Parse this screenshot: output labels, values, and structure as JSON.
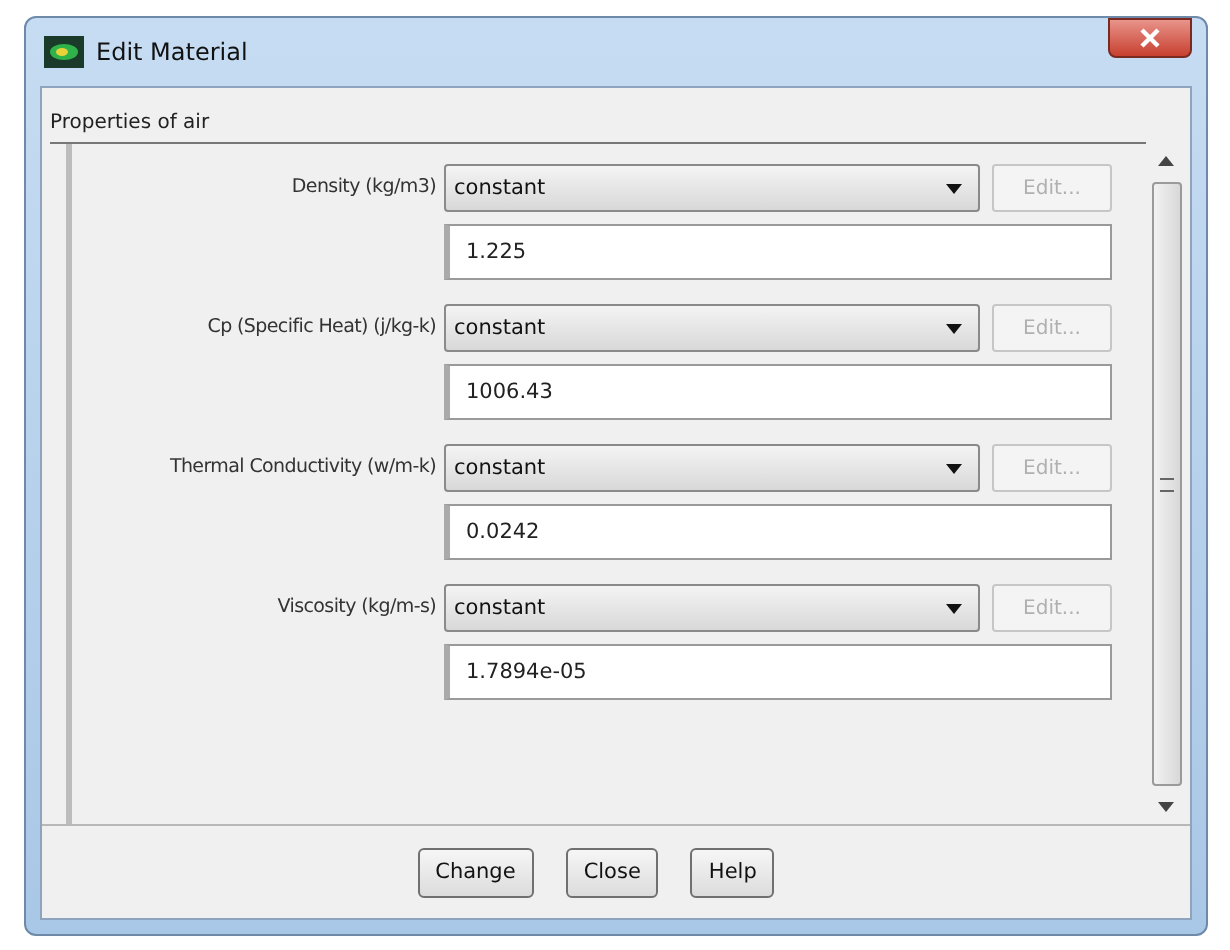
{
  "window": {
    "title": "Edit Material"
  },
  "group_title": "Properties of air",
  "properties": [
    {
      "label": "Density (kg/m3)",
      "method": "constant",
      "edit_disabled": true,
      "edit_label": "Edit...",
      "value": "1.225"
    },
    {
      "label": "Cp (Specific Heat) (j/kg-k)",
      "method": "constant",
      "edit_disabled": true,
      "edit_label": "Edit...",
      "value": "1006.43"
    },
    {
      "label": "Thermal Conductivity (w/m-k)",
      "method": "constant",
      "edit_disabled": true,
      "edit_label": "Edit...",
      "value": "0.0242"
    },
    {
      "label": "Viscosity (kg/m-s)",
      "method": "constant",
      "edit_disabled": true,
      "edit_label": "Edit...",
      "value": "1.7894e-05"
    }
  ],
  "buttons": [
    "Change",
    "Close",
    "Help"
  ]
}
